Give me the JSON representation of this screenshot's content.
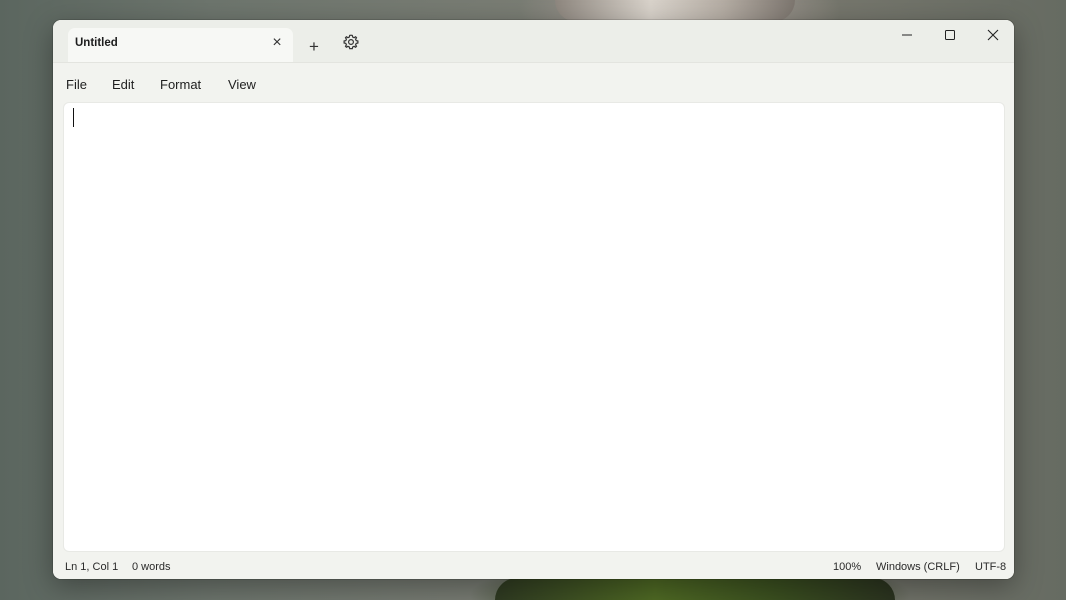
{
  "window": {
    "tab_title": "Untitled",
    "tab_close_icon": "×",
    "new_tab_icon": "+"
  },
  "menu": {
    "items": [
      "File",
      "Edit",
      "Format",
      "View"
    ]
  },
  "editor": {
    "content": ""
  },
  "status": {
    "position": "Ln 1, Col 1",
    "word_count": "0 words",
    "zoom": "100%",
    "line_ending": "Windows (CRLF)",
    "encoding": "UTF-8"
  },
  "icons": {
    "settings": "gear-icon",
    "minimize": "minimize-icon",
    "maximize": "maximize-icon",
    "close": "close-icon"
  }
}
